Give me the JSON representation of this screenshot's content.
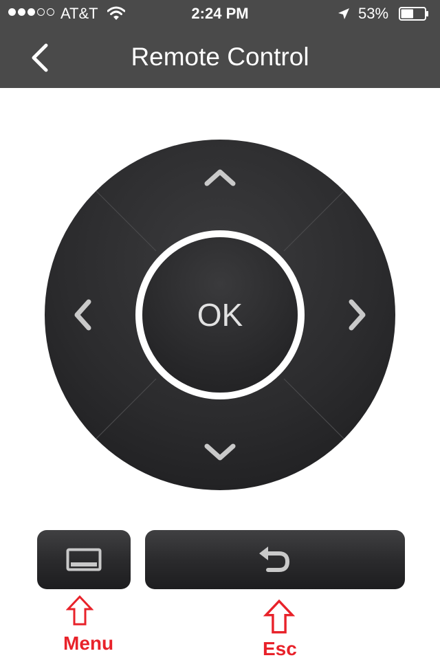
{
  "status_bar": {
    "signal_dots_filled": 3,
    "signal_dots_total": 5,
    "carrier": "AT&T",
    "wifi_icon": "wifi-icon",
    "time": "2:24 PM",
    "location_icon": "location-arrow-icon",
    "battery_percent_text": "53%",
    "battery_level": 0.53
  },
  "nav": {
    "back_icon": "chevron-left-icon",
    "title": "Remote Control"
  },
  "dpad": {
    "up_icon": "chevron-up-icon",
    "down_icon": "chevron-down-icon",
    "left_icon": "chevron-left-icon",
    "right_icon": "chevron-right-icon",
    "ok_label": "OK"
  },
  "buttons": {
    "menu_icon": "menu-screen-icon",
    "esc_icon": "undo-arrow-icon"
  },
  "annotations": {
    "menu_label": "Menu",
    "esc_label": "Esc",
    "color": "#e8222a"
  },
  "colors": {
    "bar_background": "#4a4a4a",
    "pad_background": "#2d2d2f",
    "glyph": "#c9c9c9"
  }
}
